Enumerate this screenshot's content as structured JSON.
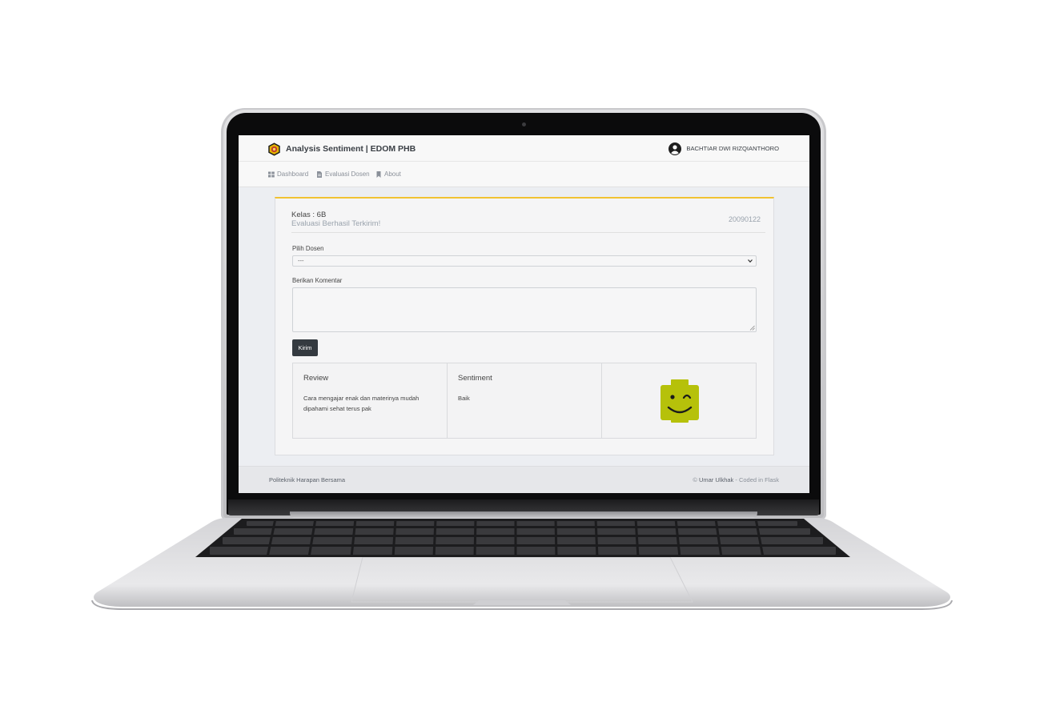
{
  "app": {
    "title": "Analysis Sentiment | EDOM PHB"
  },
  "user": {
    "name": "BACHTIAR DWI RIZQIANTHORO"
  },
  "nav": {
    "items": [
      {
        "label": "Dashboard",
        "icon": "grid-icon"
      },
      {
        "label": "Evaluasi Dosen",
        "icon": "document-icon"
      },
      {
        "label": "About",
        "icon": "bookmark-icon"
      }
    ]
  },
  "card": {
    "kelas": "Kelas : 6B",
    "status": "Evaluasi Berhasil Terkirim!",
    "nim": "20090122",
    "accent_color": "#f1c232"
  },
  "form": {
    "dosen_label": "Pilih Dosen",
    "dosen_selected": "---",
    "komentar_label": "Berikan Komentar",
    "komentar_value": "",
    "submit_label": "Kirim"
  },
  "result": {
    "review_title": "Review",
    "review_text": "Cara mengajar enak dan materinya mudah dipahami sehat terus pak",
    "sentiment_title": "Sentiment",
    "sentiment_value": "Baik",
    "emoji": "winking-smiley-icon",
    "emoji_color": "#b6c10a"
  },
  "footer": {
    "left": "Politeknik Harapan Bersama",
    "right_prefix": "© ",
    "author": "Umar Ulkhak",
    "right_suffix": " - Coded in Flask"
  }
}
